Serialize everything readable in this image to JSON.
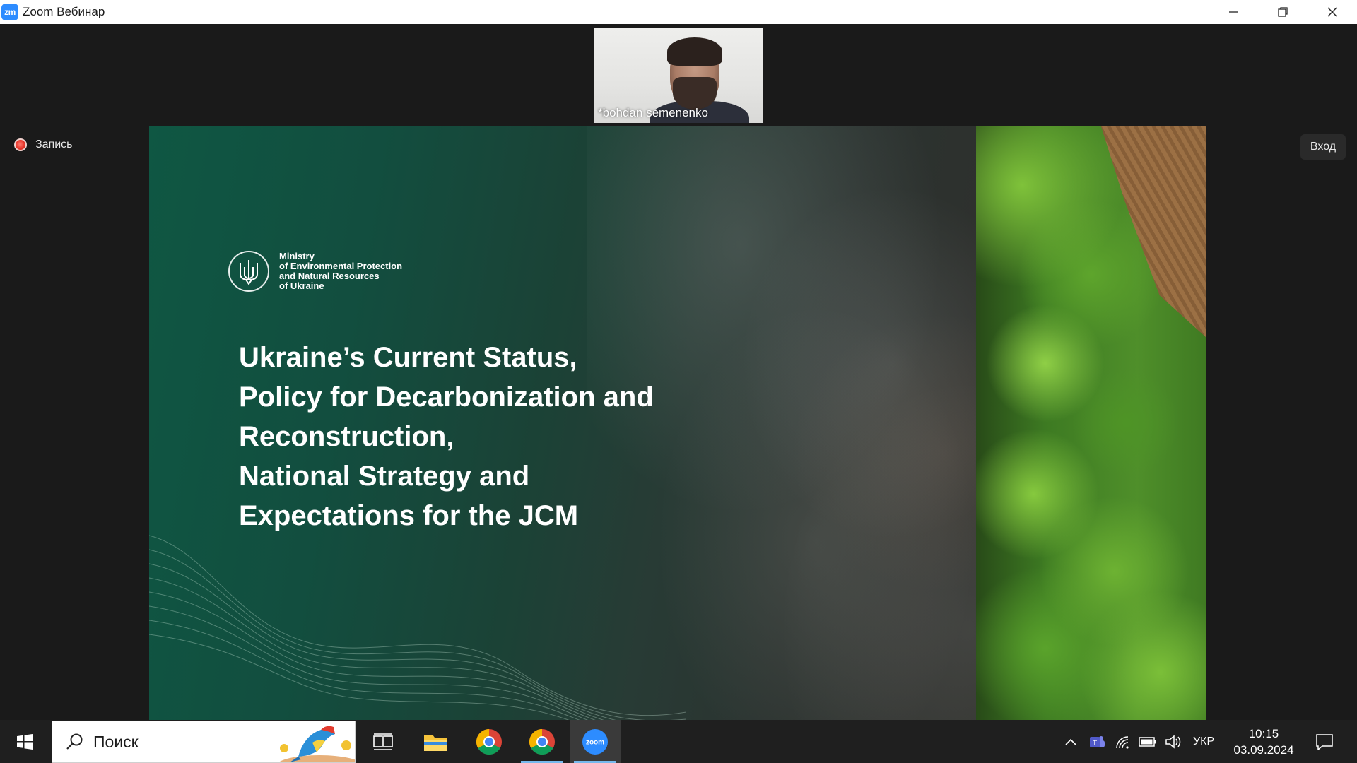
{
  "window": {
    "title": "Zoom Вебинар",
    "app_icon_text": "zm",
    "controls": [
      "minimize-icon",
      "restore-icon",
      "close-icon"
    ]
  },
  "meeting": {
    "participant_name": "*bohdan semenenko",
    "recording_label": "Запись",
    "login_label": "Вход"
  },
  "slide": {
    "ministry_lines": [
      "Ministry",
      "of Environmental Protection",
      "and Natural Resources",
      "of Ukraine"
    ],
    "title_lines": [
      "Ukraine’s Current Status,",
      "Policy for Decarbonization and",
      "Reconstruction,",
      "National Strategy and",
      "Expectations for the JCM"
    ]
  },
  "taskbar": {
    "search_placeholder": "Поиск",
    "apps": [
      "task-view-icon",
      "file-explorer-icon",
      "chrome-icon",
      "chrome-icon",
      "zoom-icon"
    ],
    "active_app": "zoom",
    "language": "УКР",
    "time": "10:15",
    "date": "03.09.2024",
    "colors": {
      "taskbar": "#1f1f1f",
      "active_indicator": "#76b9ed",
      "zoom_blue": "#2d8cff"
    }
  }
}
